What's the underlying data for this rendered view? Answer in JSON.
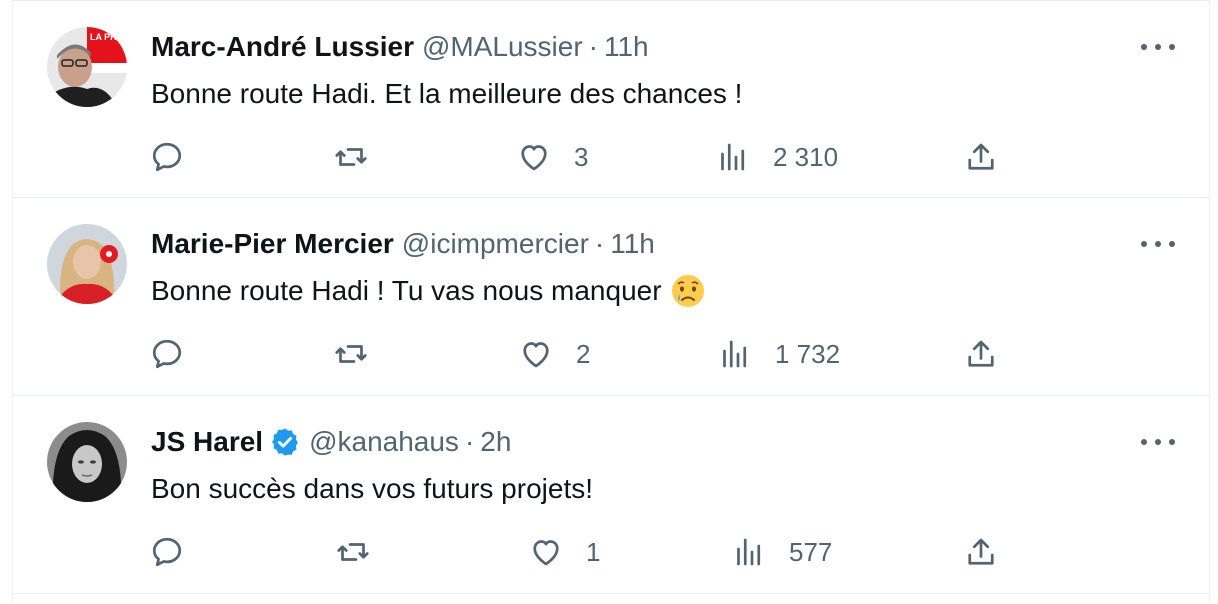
{
  "tweets": [
    {
      "name": "Marc-André Lussier",
      "handle": "@MALussier",
      "separator": "·",
      "time": "11h",
      "text": "Bonne route Hadi. Et la meilleure des chances !",
      "emoji": "",
      "verified": false,
      "reply_count": "",
      "retweet_count": "",
      "like_count": "3",
      "view_count": "2 310",
      "avatar_badge": "LA PRESSE"
    },
    {
      "name": "Marie-Pier Mercier",
      "handle": "@icimpmercier",
      "separator": "·",
      "time": "11h",
      "text": "Bonne route Hadi ! Tu vas nous manquer",
      "emoji": "crying-face",
      "verified": false,
      "reply_count": "",
      "retweet_count": "",
      "like_count": "2",
      "view_count": "1 732"
    },
    {
      "name": "JS Harel",
      "handle": "@kanahaus",
      "separator": "·",
      "time": "2h",
      "text": "Bon succès dans vos futurs projets!",
      "emoji": "",
      "verified": true,
      "reply_count": "",
      "retweet_count": "",
      "like_count": "1",
      "view_count": "577"
    }
  ],
  "colors": {
    "text_primary": "#0f1419",
    "text_secondary": "#536471",
    "verified_blue": "#1d9bf0",
    "border": "#e6ecf0"
  }
}
